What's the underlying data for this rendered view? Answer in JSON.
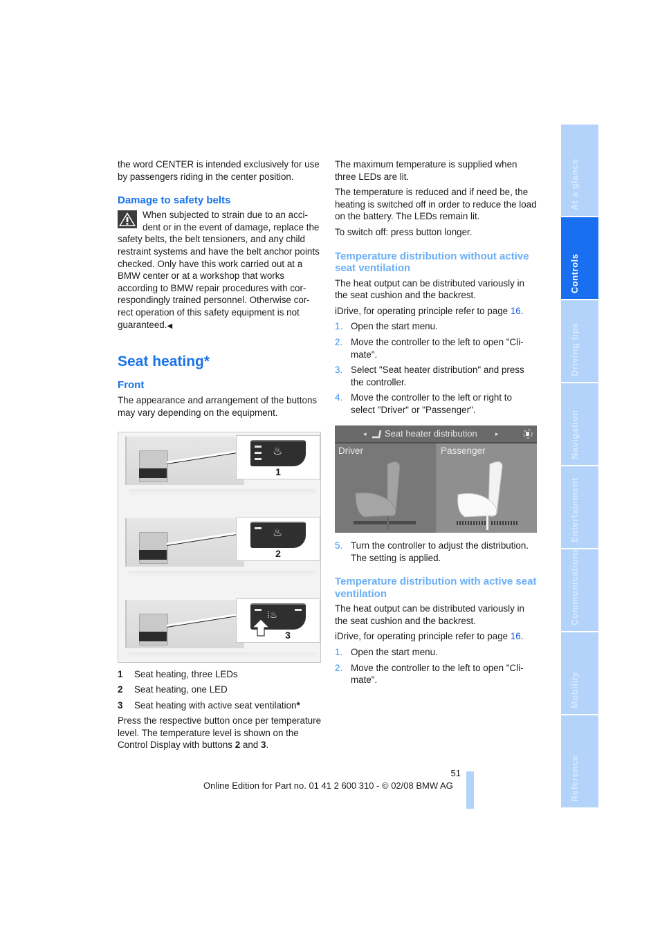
{
  "left_column": {
    "intro_text": "the word CENTER is intended exclusively for use by passengers riding in the center position.",
    "damage_heading": "Damage to safety belts",
    "warning_icon": "warning-triangle-icon",
    "warning_text": "When subjected to strain due to an acci­dent or in the event of damage, replace the safety belts, the belt tensioners, and any child restraint systems and have the belt anchor points checked. Only have this work carried out at a BMW center or at a workshop that works according to BMW repair procedures with cor­respondingly trained personnel. Otherwise cor­rect operation of this safety equipment is not guaranteed.",
    "end_mark": "◀",
    "section_title": "Seat heating*",
    "front_heading": "Front",
    "front_text": "The appearance and arrangement of the but­tons may vary depending on the equipment.",
    "figure_buttons": {
      "callouts": [
        {
          "number": "1",
          "leds": 3
        },
        {
          "number": "2",
          "leds": 1
        },
        {
          "number": "3",
          "leds": 1
        }
      ]
    },
    "legend": [
      {
        "n": "1",
        "text": "Seat heating, three LEDs"
      },
      {
        "n": "2",
        "text": "Seat heating, one LED"
      },
      {
        "n": "3",
        "text": "Seat heating with active seat ventilation",
        "asterisk": "*"
      }
    ],
    "press_text_1": "Press the respective button once per tempera­ture level. The temperature level is shown on the Control Display with buttons ",
    "press_b1": "2",
    "press_and": " and ",
    "press_b2": "3",
    "press_end": "."
  },
  "right_column": {
    "p1": "The maximum temperature is supplied when three LEDs are lit.",
    "p2": "The temperature is reduced and if need be, the heating is switched off in order to reduce the load on the battery. The LEDs remain lit.",
    "p3": "To switch off: press button longer.",
    "section1": {
      "heading": "Temperature distribution without active seat ventilation",
      "text": "The heat output can be distributed variously in the seat cushion and the backrest.",
      "idrive_prefix": "iDrive, for operating principle refer to page ",
      "idrive_page": "16",
      "idrive_suffix": ".",
      "steps": [
        {
          "n": "1.",
          "text": "Open the start menu."
        },
        {
          "n": "2.",
          "text": "Move the controller to the left to open \"Cli­mate\"."
        },
        {
          "n": "3.",
          "text": "Select \"Seat heater distribution\" and press the controller."
        },
        {
          "n": "4.",
          "text": "Move the controller to the left or right to select \"Driver\" or \"Passenger\"."
        }
      ],
      "screen": {
        "title": "Seat heater distribution",
        "left_label": "Driver",
        "right_label": "Passenger",
        "selected": "Passenger"
      },
      "step5": {
        "n": "5.",
        "text": "Turn the controller to adjust the distribu­tion.",
        "sub": "The setting is applied."
      }
    },
    "section2": {
      "heading": "Temperature distribution with active seat ventilation",
      "text": "The heat output can be distributed variously in the seat cushion and the backrest.",
      "idrive_prefix": "iDrive, for operating principle refer to page ",
      "idrive_page": "16",
      "idrive_suffix": ".",
      "steps": [
        {
          "n": "1.",
          "text": "Open the start menu."
        },
        {
          "n": "2.",
          "text": "Move the controller to the left to open \"Cli­mate\"."
        }
      ]
    }
  },
  "side_tabs": [
    {
      "label": "At a glance",
      "active": false
    },
    {
      "label": "Controls",
      "active": true
    },
    {
      "label": "Driving tips",
      "active": false
    },
    {
      "label": "Navigation",
      "active": false
    },
    {
      "label": "Entertainment",
      "active": false
    },
    {
      "label": "Communications",
      "active": false
    },
    {
      "label": "Mobility",
      "active": false
    },
    {
      "label": "Reference",
      "active": false
    }
  ],
  "colors": {
    "heading_blue": "#1a73e8",
    "subheading_light_blue": "#6aaef5",
    "tab_inactive": "#b3d3fb",
    "tab_active": "#1a6ff0"
  },
  "footer": {
    "page_number": "51",
    "edition_text": "Online Edition for Part no. 01 41 2 600 310 - © 02/08 BMW AG"
  }
}
